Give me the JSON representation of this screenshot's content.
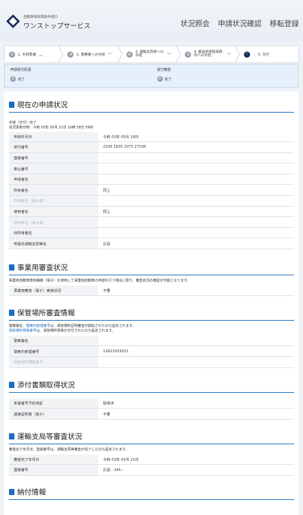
{
  "header": {
    "logo_line1": "自動車保有関係手続の",
    "logo_line2": "ワンストップサービス",
    "nav": [
      "状況照会",
      "申請状況確認",
      "移転登録"
    ]
  },
  "steps": [
    {
      "label": "1. 手続準備",
      "icon": "済"
    },
    {
      "label": "2. 警察署への手続",
      "icon": "済"
    },
    {
      "label": "3. 運輸支局等への手続",
      "icon": "済"
    },
    {
      "label": "4. 都道府県税事務所への手続",
      "icon": "済"
    },
    {
      "label": "5. 交付",
      "icon": "!"
    }
  ],
  "status": {
    "receipt_label": "申請受付処理",
    "receipt_value": "完了",
    "review_label": "受付審査",
    "review_value": "完了",
    "icon": "済"
  },
  "current": {
    "title": "現在の申請状況",
    "note1": "手続（交付）完了",
    "note2": "状況更新日時：令和 03年 05月 21日 10時 58分 59秒",
    "rows": [
      {
        "k": "申請年月日",
        "v": "令和 03年 05月 18日"
      },
      {
        "k": "受付番号",
        "v": "2105 1820 1073 27108"
      },
      {
        "k": "登録番号",
        "v": ""
      },
      {
        "k": "車台番号",
        "v": ""
      },
      {
        "k": "申請者名",
        "v": ""
      },
      {
        "k": "所有者名",
        "v": "同上"
      },
      {
        "k": "所有者名（最大値）",
        "v": "",
        "dim": true
      },
      {
        "k": "使用者名",
        "v": "同上"
      },
      {
        "k": "使用者名（最大値）",
        "v": "",
        "dim": true
      },
      {
        "k": "旧所有者名",
        "v": ""
      },
      {
        "k": "申請先運輸支局等名",
        "v": "広島"
      }
    ]
  },
  "business": {
    "title": "事業用審査状況",
    "note": "事業用自動車専用繊維（電子）を使用して事業用自動車の申請を行う場合に限り、審査状況の確認が可能となります。",
    "rows": [
      {
        "k": "事業用審査（電子）実施状況",
        "v": "不要"
      }
    ]
  },
  "parking": {
    "title": "保管場所審査情報",
    "note1_pre": "警察署名、",
    "note1_link": "警察内管理番号",
    "note1_post": "は、保管場所証明審査が開始されたのち設定されます。",
    "note2_link": "保管場所標章番号",
    "note2_post": "は、保管場所標章が交付されたのち設定されます。",
    "rows": [
      {
        "k": "警察署名",
        "v": ""
      },
      {
        "k": "警察内管理番号",
        "v": "12621501651"
      },
      {
        "k": "保管場所標章番号",
        "v": "",
        "dim": true
      }
    ]
  },
  "attach": {
    "title": "添付書類取得状況",
    "rows": [
      {
        "k": "希望番号予約済証",
        "v": "取得済"
      },
      {
        "k": "譲渡証明書（電子）",
        "v": "不要"
      }
    ]
  },
  "transport": {
    "title": "運輸支局等審査状況",
    "note": "審査完了年月日、登録番号は、運輸支局等審査が完了したのち設定されます。",
    "rows": [
      {
        "k": "審査完了年月日",
        "v": "令和 03年 05月 21日"
      },
      {
        "k": "登録番号",
        "v": "広島 - 345 -"
      }
    ]
  },
  "payment": {
    "title": "納付情報"
  }
}
